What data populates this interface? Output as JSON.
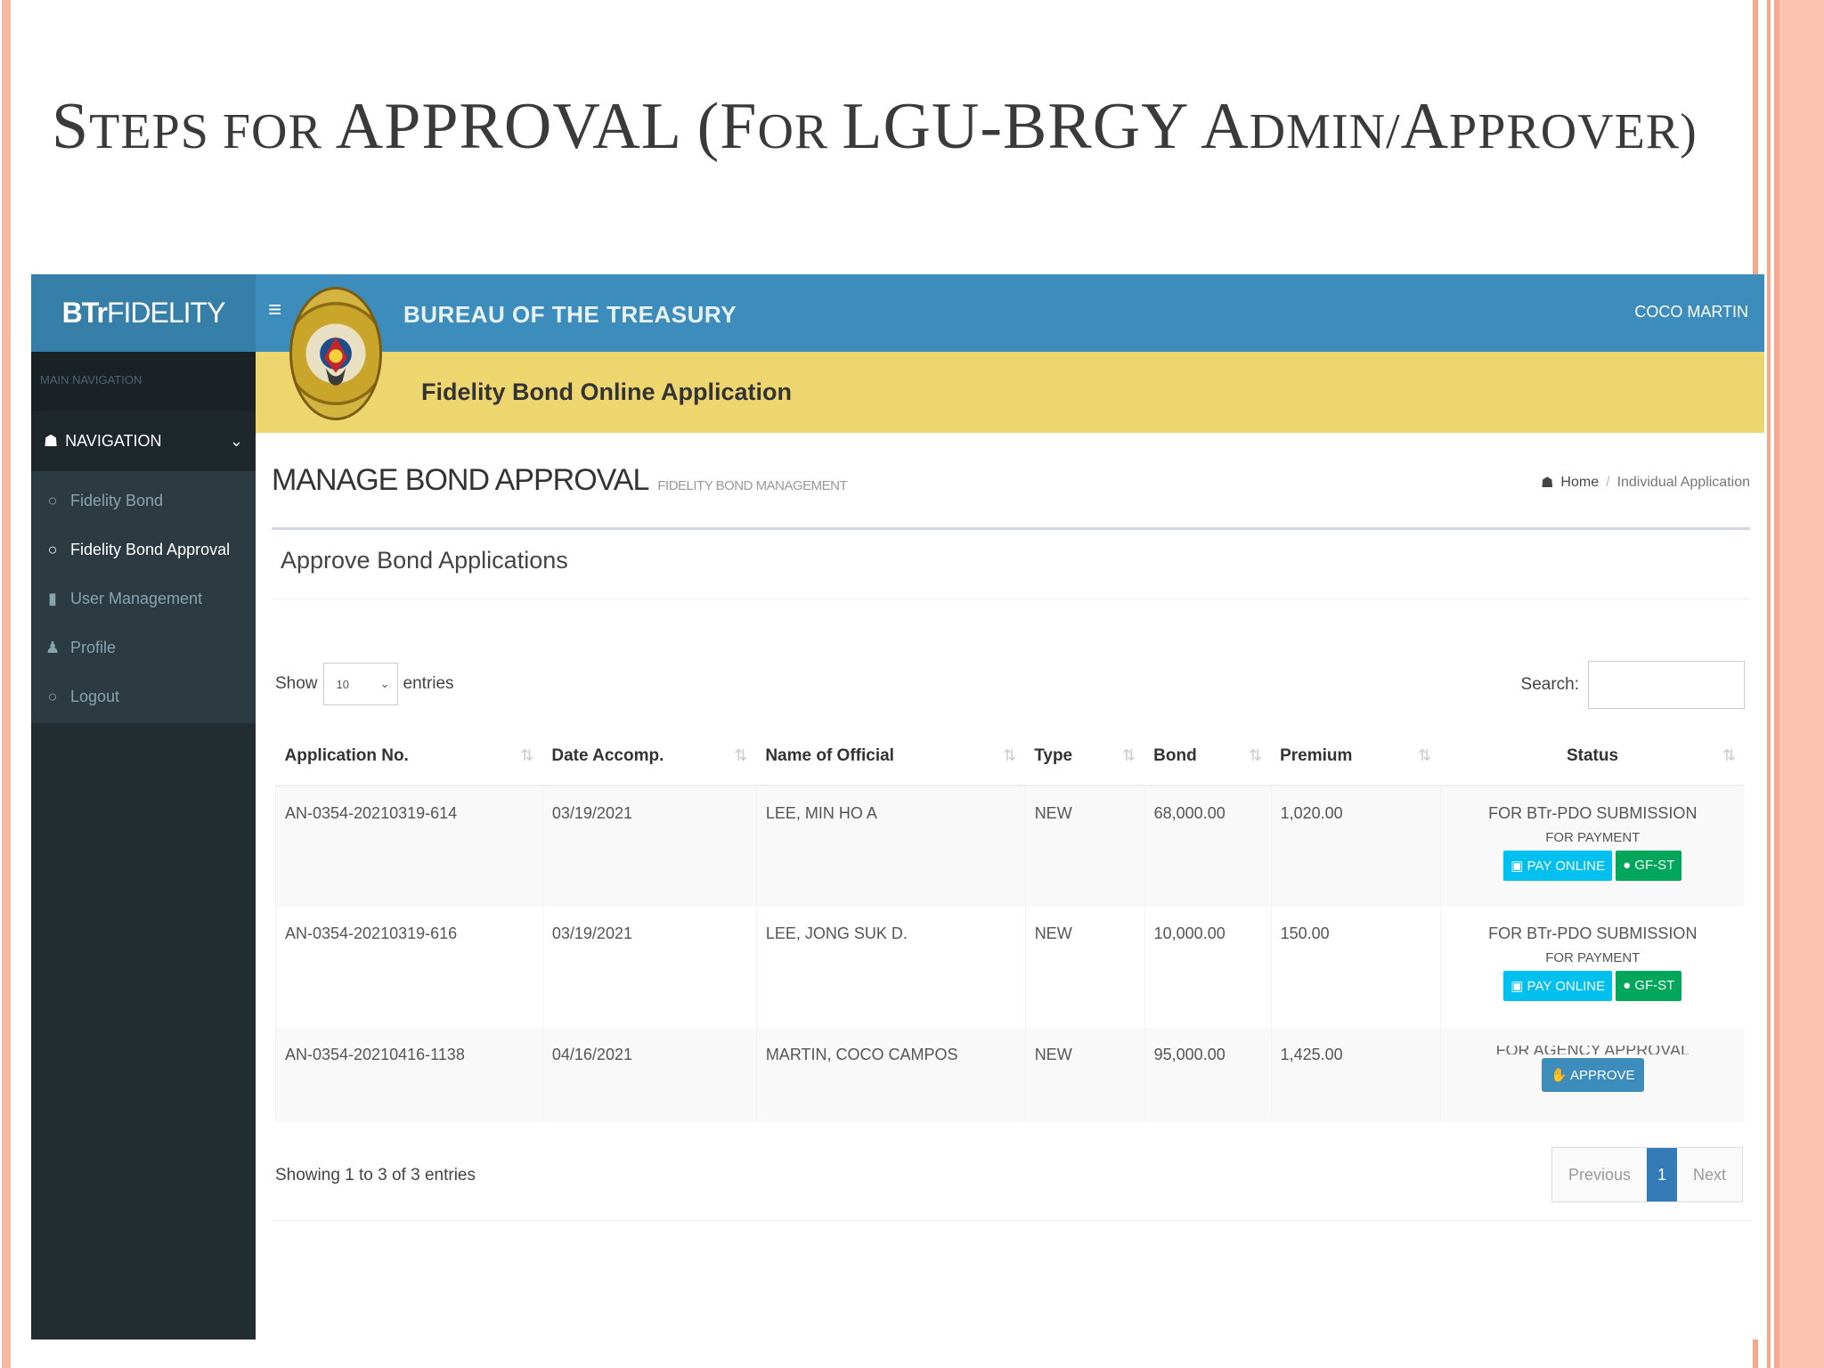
{
  "slide": {
    "title_parts": {
      "s1": "S",
      "s2": "TEPS FOR ",
      "s3": "APPROVAL (",
      "s4": "F",
      "s5": "OR ",
      "s6": "LGU-BRGY ",
      "s7": "A",
      "s8": "DMIN/",
      "s9": "A",
      "s10": "PPROVER)"
    }
  },
  "app": {
    "brand": {
      "bold": "BTr",
      "rest": "FIDELITY"
    },
    "topbar": {
      "menu_icon": "≡",
      "org": "BUREAU OF THE TREASURY",
      "user": "COCO MARTIN"
    },
    "banner": {
      "title": "Fidelity Bond Online Application"
    },
    "sidebar": {
      "main_label": "MAIN NAVIGATION",
      "header": "NAVIGATION",
      "items": [
        {
          "label": "Fidelity Bond",
          "icon": "circle-icon"
        },
        {
          "label": "Fidelity Bond Approval",
          "icon": "circle-icon"
        },
        {
          "label": "User Management",
          "icon": "users-icon"
        },
        {
          "label": "Profile",
          "icon": "user-icon"
        },
        {
          "label": "Logout",
          "icon": "circle-icon"
        }
      ]
    },
    "page": {
      "title": "MANAGE BOND APPROVAL",
      "subtitle": "FIDELITY BOND MANAGEMENT",
      "breadcrumb": {
        "home": "Home",
        "current": "Individual Application"
      },
      "box_title": "Approve Bond Applications",
      "length": {
        "show": "Show",
        "value": "10",
        "entries": "entries"
      },
      "search_label": "Search:",
      "table": {
        "headers": [
          "Application No.",
          "Date Accomp.",
          "Name of Official",
          "Type",
          "Bond",
          "Premium",
          "Status"
        ],
        "rows": [
          {
            "app_no": "AN-0354-20210319-614",
            "date": "03/19/2021",
            "name": "LEE, MIN HO A",
            "type": "NEW",
            "bond": "68,000.00",
            "premium": "1,020.00",
            "status": "FOR BTr-PDO SUBMISSION",
            "sub": "FOR PAYMENT",
            "btn1": "PAY ONLINE",
            "btn2": "GF-ST"
          },
          {
            "app_no": "AN-0354-20210319-616",
            "date": "03/19/2021",
            "name": "LEE, JONG SUK D.",
            "type": "NEW",
            "bond": "10,000.00",
            "premium": "150.00",
            "status": "FOR BTr-PDO SUBMISSION",
            "sub": "FOR PAYMENT",
            "btn1": "PAY ONLINE",
            "btn2": "GF-ST"
          },
          {
            "app_no": "AN-0354-20210416-1138",
            "date": "04/16/2021",
            "name": "MARTIN, COCO CAMPOS",
            "type": "NEW",
            "bond": "95,000.00",
            "premium": "1,425.00",
            "status": "FOR AGENCY APPROVAL",
            "btn": "APPROVE"
          }
        ]
      },
      "info": "Showing 1 to 3 of 3 entries",
      "pager": {
        "prev": "Previous",
        "page": "1",
        "next": "Next"
      }
    }
  },
  "colors": {
    "sidebar": "#222d32",
    "topbar": "#3c8dbc",
    "banner": "#eed66f",
    "highlight_ring": "#d8262a"
  }
}
